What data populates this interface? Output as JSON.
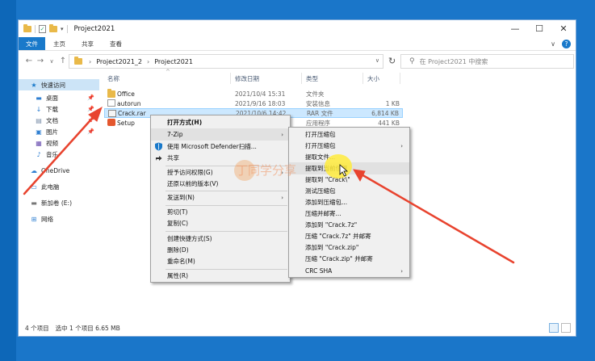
{
  "window": {
    "title": "Project2021",
    "controls": {
      "minimize": "—",
      "maximize": "☐",
      "close": "✕"
    }
  },
  "ribbon": {
    "tabs": [
      "文件",
      "主页",
      "共享",
      "查看"
    ],
    "collapse": "∨",
    "help": "?"
  },
  "address": {
    "crumbs": [
      "Project2021_2",
      "Project2021"
    ],
    "search_placeholder": "搜索\"Project2021\"",
    "search_label": "在 Project2021 中搜索"
  },
  "sidebar": {
    "items": [
      {
        "label": "快速访问",
        "icon": "star-icon"
      },
      {
        "label": "桌面",
        "icon": "desktop-icon"
      },
      {
        "label": "下载",
        "icon": "download-icon"
      },
      {
        "label": "文档",
        "icon": "document-icon"
      },
      {
        "label": "图片",
        "icon": "picture-icon"
      },
      {
        "label": "视频",
        "icon": "video-icon"
      },
      {
        "label": "音乐",
        "icon": "music-icon"
      },
      {
        "label": "OneDrive",
        "icon": "cloud-icon"
      },
      {
        "label": "此电脑",
        "icon": "computer-icon"
      },
      {
        "label": "新加卷 (E:)",
        "icon": "drive-icon"
      },
      {
        "label": "网络",
        "icon": "network-icon"
      }
    ]
  },
  "columns": {
    "name": "名称",
    "date": "修改日期",
    "type": "类型",
    "size": "大小"
  },
  "files": [
    {
      "name": "Office",
      "date": "2021/10/4 15:31",
      "type": "文件夹",
      "size": ""
    },
    {
      "name": "autorun",
      "date": "2021/9/16 18:03",
      "type": "安装信息",
      "size": "1 KB"
    },
    {
      "name": "Crack.rar",
      "date": "2021/10/6 14:42",
      "type": "RAR 文件",
      "size": "6,814 KB"
    },
    {
      "name": "Setup",
      "date": "",
      "type": "应用程序",
      "size": "441 KB"
    }
  ],
  "status": {
    "count": "4 个项目",
    "selected": "选中 1 个项目  6.65 MB"
  },
  "context_menu": {
    "items": [
      {
        "label": "打开方式(H)",
        "bold": true
      },
      {
        "label": "7-Zip",
        "submenu": true
      },
      {
        "label": "使用 Microsoft Defender扫描...",
        "icon": "defender-icon"
      },
      {
        "label": "共享",
        "icon": "share-icon"
      },
      {
        "label": "授予访问权限(G)",
        "submenu": true
      },
      {
        "label": "还原以前的版本(V)"
      },
      {
        "label": "发送到(N)",
        "submenu": true
      },
      {
        "label": "剪切(T)"
      },
      {
        "label": "复制(C)"
      },
      {
        "label": "创建快捷方式(S)"
      },
      {
        "label": "删除(D)"
      },
      {
        "label": "重命名(M)"
      },
      {
        "label": "属性(R)"
      }
    ]
  },
  "zip_menu": {
    "items": [
      {
        "label": "打开压缩包"
      },
      {
        "label": "打开压缩包",
        "submenu": true
      },
      {
        "label": "提取文件..."
      },
      {
        "label": "提取到当前位置"
      },
      {
        "label": "提取到 \"Crack\\\""
      },
      {
        "label": "测试压缩包"
      },
      {
        "label": "添加到压缩包..."
      },
      {
        "label": "压缩并邮寄..."
      },
      {
        "label": "添加到 \"Crack.7z\""
      },
      {
        "label": "压缩 \"Crack.7z\" 并邮寄"
      },
      {
        "label": "添加到 \"Crack.zip\""
      },
      {
        "label": "压缩 \"Crack.zip\" 并邮寄"
      },
      {
        "label": "CRC SHA",
        "submenu": true
      }
    ]
  },
  "watermark": "丁同学分享",
  "colors": {
    "accent": "#1979ca",
    "arrow": "#e8432e",
    "selection": "#cce8ff"
  }
}
